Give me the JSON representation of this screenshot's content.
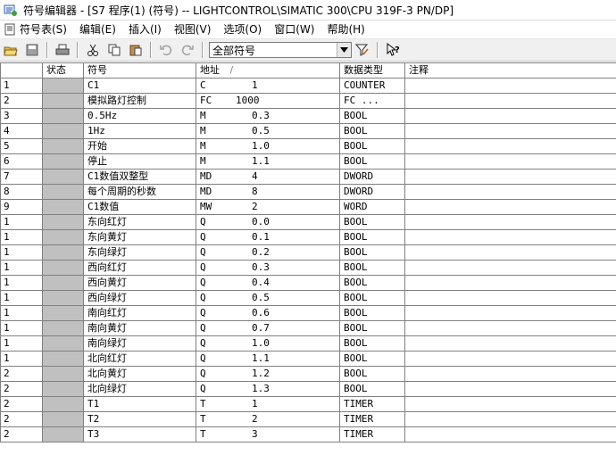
{
  "window": {
    "title": "符号编辑器 - [S7 程序(1) (符号) -- LIGHTCONTROL\\SIMATIC 300\\CPU 319F-3 PN/DP]"
  },
  "menu": [
    "符号表(S)",
    "编辑(E)",
    "插入(I)",
    "视图(V)",
    "选项(O)",
    "窗口(W)",
    "帮助(H)"
  ],
  "toolbar": {
    "filter_value": "全部符号",
    "icons": [
      "open-icon",
      "save-icon",
      "print-icon",
      "cut-icon",
      "copy-icon",
      "paste-icon",
      "undo-icon",
      "redo-icon",
      "filter-icon",
      "help-icon"
    ]
  },
  "table": {
    "headers": {
      "rownum": "",
      "state": "状态",
      "symbol": "符号",
      "address": "地址",
      "sort_mark": "/",
      "datatype": "数据类型",
      "comment": "注释"
    },
    "rows": [
      {
        "num": "1",
        "symbol": "C1",
        "type": "C",
        "addr": "1",
        "datatype": "COUNTER",
        "comment": ""
      },
      {
        "num": "2",
        "symbol": "模拟路灯控制",
        "type": "FC",
        "addr": "1000",
        "datatype": "FC   ...",
        "comment": ""
      },
      {
        "num": "3",
        "symbol": "0.5Hz",
        "type": "M",
        "addr": "0.3",
        "datatype": "BOOL",
        "comment": ""
      },
      {
        "num": "4",
        "symbol": "1Hz",
        "type": "M",
        "addr": "0.5",
        "datatype": "BOOL",
        "comment": ""
      },
      {
        "num": "5",
        "symbol": "开始",
        "type": "M",
        "addr": "1.0",
        "datatype": "BOOL",
        "comment": ""
      },
      {
        "num": "6",
        "symbol": "停止",
        "type": "M",
        "addr": "1.1",
        "datatype": "BOOL",
        "comment": ""
      },
      {
        "num": "7",
        "symbol": "C1数值双整型",
        "type": "MD",
        "addr": "4",
        "datatype": "DWORD",
        "comment": ""
      },
      {
        "num": "8",
        "symbol": "每个周期的秒数",
        "type": "MD",
        "addr": "8",
        "datatype": "DWORD",
        "comment": ""
      },
      {
        "num": "9",
        "symbol": "C1数值",
        "type": "MW",
        "addr": "2",
        "datatype": "WORD",
        "comment": ""
      },
      {
        "num": "1",
        "symbol": "东向红灯",
        "type": "Q",
        "addr": "0.0",
        "datatype": "BOOL",
        "comment": ""
      },
      {
        "num": "1",
        "symbol": "东向黄灯",
        "type": "Q",
        "addr": "0.1",
        "datatype": "BOOL",
        "comment": ""
      },
      {
        "num": "1",
        "symbol": "东向绿灯",
        "type": "Q",
        "addr": "0.2",
        "datatype": "BOOL",
        "comment": ""
      },
      {
        "num": "1",
        "symbol": "西向红灯",
        "type": "Q",
        "addr": "0.3",
        "datatype": "BOOL",
        "comment": ""
      },
      {
        "num": "1",
        "symbol": "西向黄灯",
        "type": "Q",
        "addr": "0.4",
        "datatype": "BOOL",
        "comment": ""
      },
      {
        "num": "1",
        "symbol": "西向绿灯",
        "type": "Q",
        "addr": "0.5",
        "datatype": "BOOL",
        "comment": ""
      },
      {
        "num": "1",
        "symbol": "南向红灯",
        "type": "Q",
        "addr": "0.6",
        "datatype": "BOOL",
        "comment": ""
      },
      {
        "num": "1",
        "symbol": "南向黄灯",
        "type": "Q",
        "addr": "0.7",
        "datatype": "BOOL",
        "comment": ""
      },
      {
        "num": "1",
        "symbol": "南向绿灯",
        "type": "Q",
        "addr": "1.0",
        "datatype": "BOOL",
        "comment": ""
      },
      {
        "num": "1",
        "symbol": "北向红灯",
        "type": "Q",
        "addr": "1.1",
        "datatype": "BOOL",
        "comment": ""
      },
      {
        "num": "2",
        "symbol": "北向黄灯",
        "type": "Q",
        "addr": "1.2",
        "datatype": "BOOL",
        "comment": ""
      },
      {
        "num": "2",
        "symbol": "北向绿灯",
        "type": "Q",
        "addr": "1.3",
        "datatype": "BOOL",
        "comment": ""
      },
      {
        "num": "2",
        "symbol": "T1",
        "type": "T",
        "addr": "1",
        "datatype": "TIMER",
        "comment": ""
      },
      {
        "num": "2",
        "symbol": "T2",
        "type": "T",
        "addr": "2",
        "datatype": "TIMER",
        "comment": ""
      },
      {
        "num": "2",
        "symbol": "T3",
        "type": "T",
        "addr": "3",
        "datatype": "TIMER",
        "comment": ""
      }
    ]
  }
}
